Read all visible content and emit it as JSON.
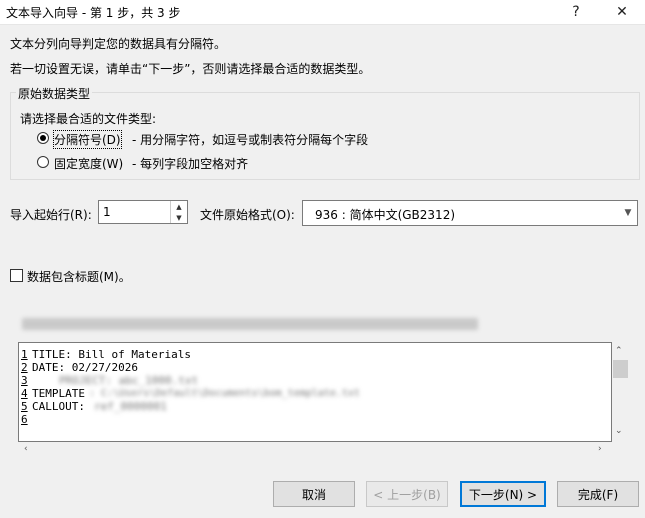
{
  "window": {
    "title": "文本导入向导 - 第 1 步，共 3 步",
    "help_glyph": "?",
    "close_glyph": "✕"
  },
  "intro": {
    "line1": "文本分列向导判定您的数据具有分隔符。",
    "line2": "若一切设置无误，请单击“下一步”，否则请选择最合适的数据类型。"
  },
  "group": {
    "label": "原始数据类型",
    "prompt": "请选择最合适的文件类型:",
    "options": [
      {
        "label": "分隔符号(D)",
        "description": "- 用分隔字符，如逗号或制表符分隔每个字段",
        "selected": true
      },
      {
        "label": "固定宽度(W)",
        "description": "- 每列字段加空格对齐",
        "selected": false
      }
    ]
  },
  "start_row": {
    "label": "导入起始行(R):",
    "value": "1"
  },
  "file_origin": {
    "label": "文件原始格式(O):",
    "value": "936 : 简体中文(GB2312)"
  },
  "has_headers": {
    "label": "数据包含标题(M)。",
    "checked": false
  },
  "preview": {
    "rows": [
      {
        "num": "1",
        "text": "TITLE: Bill of Materials",
        "blur": ""
      },
      {
        "num": "2",
        "text": "DATE: 02/27/2026",
        "blur": ""
      },
      {
        "num": "3",
        "text": "",
        "blur": "PROJECT: abc_1000.txt"
      },
      {
        "num": "4",
        "text": "TEMPLATE",
        "blur": ": C:\\Users\\Default\\Documents\\bom_template.txt"
      },
      {
        "num": "5",
        "text": "CALLOUT:",
        "blur": " ref_0000001"
      },
      {
        "num": "6",
        "text": "",
        "blur": ""
      }
    ]
  },
  "buttons": {
    "cancel": "取消",
    "back": "< 上一步(B)",
    "next": "下一步(N) >",
    "finish": "完成(F)"
  }
}
